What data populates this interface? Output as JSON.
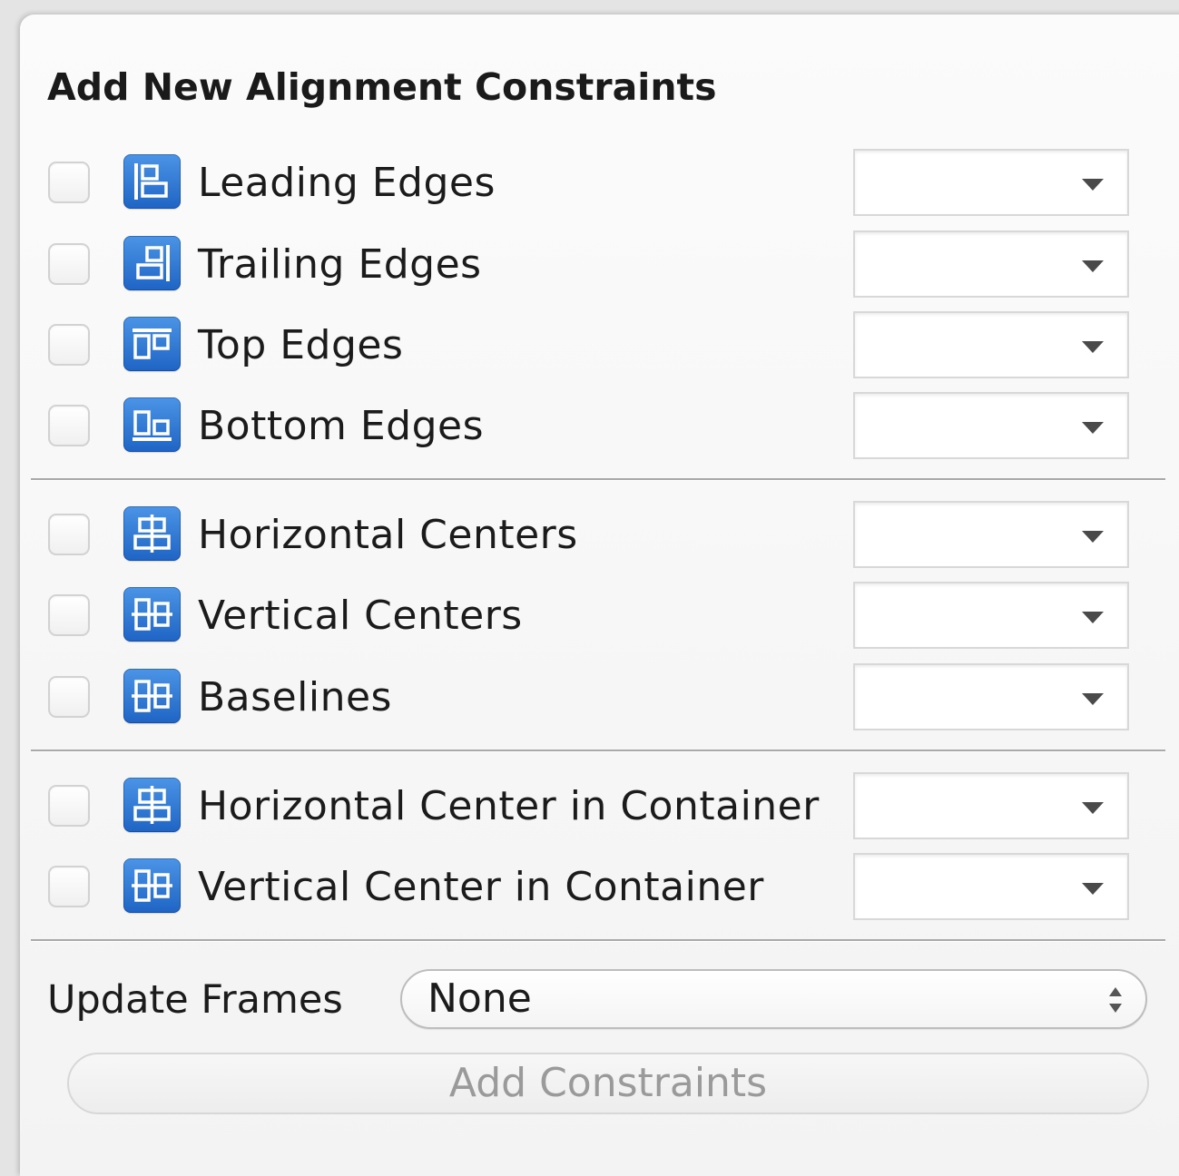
{
  "panel": {
    "title": "Add New Alignment Constraints"
  },
  "constraints": [
    {
      "label": "Leading Edges",
      "icon": "leading-edges-icon",
      "checked": false,
      "value": ""
    },
    {
      "label": "Trailing Edges",
      "icon": "trailing-edges-icon",
      "checked": false,
      "value": ""
    },
    {
      "label": "Top Edges",
      "icon": "top-edges-icon",
      "checked": false,
      "value": ""
    },
    {
      "label": "Bottom Edges",
      "icon": "bottom-edges-icon",
      "checked": false,
      "value": ""
    },
    {
      "label": "Horizontal Centers",
      "icon": "horizontal-centers-icon",
      "checked": false,
      "value": ""
    },
    {
      "label": "Vertical Centers",
      "icon": "vertical-centers-icon",
      "checked": false,
      "value": ""
    },
    {
      "label": "Baselines",
      "icon": "baselines-icon",
      "checked": false,
      "value": ""
    },
    {
      "label": "Horizontal Center in Container",
      "icon": "horizontal-center-container-icon",
      "checked": false,
      "value": ""
    },
    {
      "label": "Vertical Center in Container",
      "icon": "vertical-center-container-icon",
      "checked": false,
      "value": ""
    }
  ],
  "update_frames": {
    "label": "Update Frames",
    "value": "None"
  },
  "add_button": {
    "label": "Add Constraints",
    "enabled": false
  },
  "colors": {
    "icon_blue": "#2a6fd0",
    "disabled_text": "#9a9a9a"
  }
}
